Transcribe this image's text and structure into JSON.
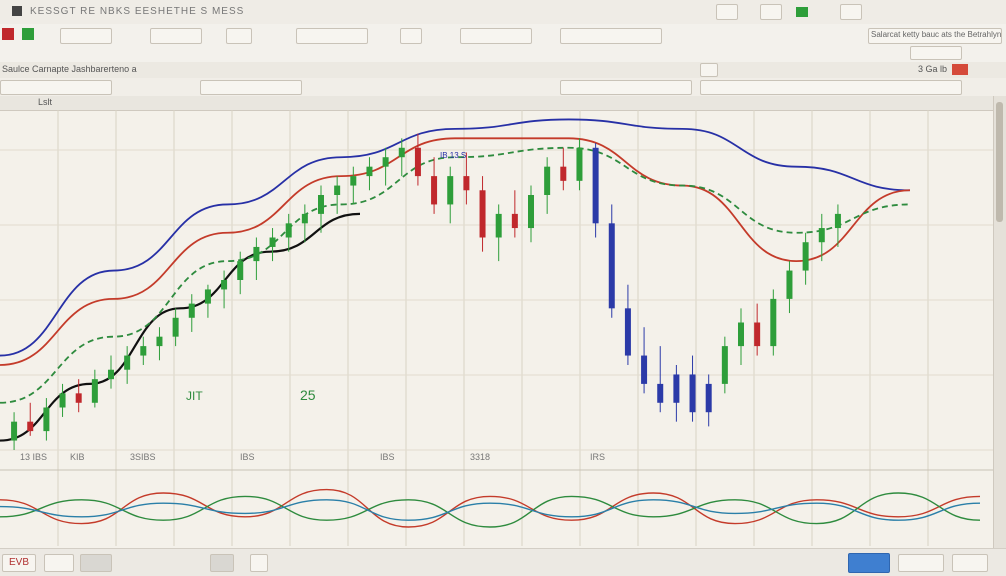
{
  "menubar": {
    "title": "KESSGT RE NBKS EESHETHE S MESS"
  },
  "toolbar": {
    "search_text": "Salarcat ketty bauc ats the Betrahlyn"
  },
  "subbar": {
    "title": "Saulce Carnapte Jashbarerteno a",
    "right": "3 Ga lb"
  },
  "ruler": {
    "left": "Lslt"
  },
  "chart_data": {
    "type": "candlestick",
    "title": "",
    "xlabel": "",
    "ylabel": "",
    "x_tick_labels": [
      "13 IBS",
      "KIB",
      "3SIBS",
      "IBS",
      "IBS",
      "3318",
      "IRS"
    ],
    "annotations": [
      "JIT",
      "25",
      "IB 13 S"
    ],
    "ohlc_series": {
      "name": "",
      "color_up": "#2e9e3a",
      "color_down": "#c0282c",
      "color_alt": "#2b3aa8",
      "ohlc": [
        [
          2,
          8,
          0,
          6
        ],
        [
          6,
          10,
          3,
          4
        ],
        [
          4,
          11,
          2,
          9
        ],
        [
          9,
          14,
          7,
          12
        ],
        [
          12,
          15,
          8,
          10
        ],
        [
          10,
          17,
          9,
          15
        ],
        [
          15,
          20,
          13,
          17
        ],
        [
          17,
          22,
          14,
          20
        ],
        [
          20,
          24,
          18,
          22
        ],
        [
          22,
          26,
          19,
          24
        ],
        [
          24,
          30,
          22,
          28
        ],
        [
          28,
          33,
          25,
          31
        ],
        [
          31,
          35,
          28,
          34
        ],
        [
          34,
          38,
          30,
          36
        ],
        [
          36,
          42,
          33,
          40
        ],
        [
          40,
          45,
          36,
          43
        ],
        [
          43,
          47,
          40,
          45
        ],
        [
          45,
          50,
          42,
          48
        ],
        [
          48,
          52,
          44,
          50
        ],
        [
          50,
          56,
          46,
          54
        ],
        [
          54,
          58,
          50,
          56
        ],
        [
          56,
          60,
          52,
          58
        ],
        [
          58,
          62,
          55,
          60
        ],
        [
          60,
          64,
          56,
          62
        ],
        [
          62,
          66,
          58,
          64
        ],
        [
          64,
          67,
          56,
          58
        ],
        [
          58,
          62,
          50,
          52
        ],
        [
          52,
          60,
          48,
          58
        ],
        [
          58,
          63,
          52,
          55
        ],
        [
          55,
          58,
          42,
          45
        ],
        [
          45,
          52,
          40,
          50
        ],
        [
          50,
          55,
          45,
          47
        ],
        [
          47,
          56,
          44,
          54
        ],
        [
          54,
          62,
          50,
          60
        ],
        [
          60,
          64,
          55,
          57
        ],
        [
          57,
          66,
          55,
          64
        ],
        [
          64,
          65,
          45,
          48
        ],
        [
          48,
          52,
          28,
          30
        ],
        [
          30,
          35,
          18,
          20
        ],
        [
          20,
          26,
          12,
          14
        ],
        [
          14,
          22,
          8,
          10
        ],
        [
          10,
          18,
          6,
          16
        ],
        [
          16,
          20,
          6,
          8
        ],
        [
          8,
          16,
          5,
          14
        ],
        [
          14,
          24,
          12,
          22
        ],
        [
          22,
          30,
          18,
          27
        ],
        [
          27,
          31,
          20,
          22
        ],
        [
          22,
          34,
          20,
          32
        ],
        [
          32,
          40,
          29,
          38
        ],
        [
          38,
          46,
          35,
          44
        ],
        [
          44,
          50,
          40,
          47
        ],
        [
          47,
          52,
          43,
          50
        ]
      ]
    },
    "line_series": [
      {
        "name": "",
        "color": "#2730a6",
        "values": [
          20,
          38,
          52,
          62,
          68,
          70,
          68,
          60,
          55
        ]
      },
      {
        "name": "",
        "color": "#c43b2a",
        "values": [
          18,
          32,
          46,
          58,
          66,
          66,
          56,
          40,
          55
        ]
      },
      {
        "name": "",
        "color": "#111111",
        "values": [
          2,
          14,
          30,
          42,
          50
        ]
      },
      {
        "name": "",
        "color": "#2e8b3e",
        "values": [
          10,
          24,
          40,
          52,
          62,
          64,
          56,
          46,
          52
        ]
      }
    ],
    "oscillator": {
      "series": [
        {
          "name": "",
          "color": "#c43b2a",
          "values": [
            0.3,
            -0.4,
            0.5,
            -0.2,
            0.6,
            -0.5,
            0.4,
            -0.3,
            0.5,
            -0.4,
            0.3,
            -0.2,
            0.4
          ]
        },
        {
          "name": "",
          "color": "#2e8b3e",
          "values": [
            -0.2,
            0.3,
            -0.3,
            0.4,
            -0.3,
            0.3,
            -0.5,
            0.4,
            -0.2,
            0.3,
            -0.4,
            0.5,
            -0.3
          ]
        },
        {
          "name": "",
          "color": "#2a7fa8",
          "values": [
            0.1,
            -0.2,
            0.2,
            -0.1,
            0.3,
            -0.3,
            0.2,
            -0.2,
            0.3,
            -0.1,
            0.2,
            -0.3,
            0.2
          ]
        }
      ]
    }
  },
  "statusbar": {
    "left": "EVB",
    "right_button": ""
  }
}
